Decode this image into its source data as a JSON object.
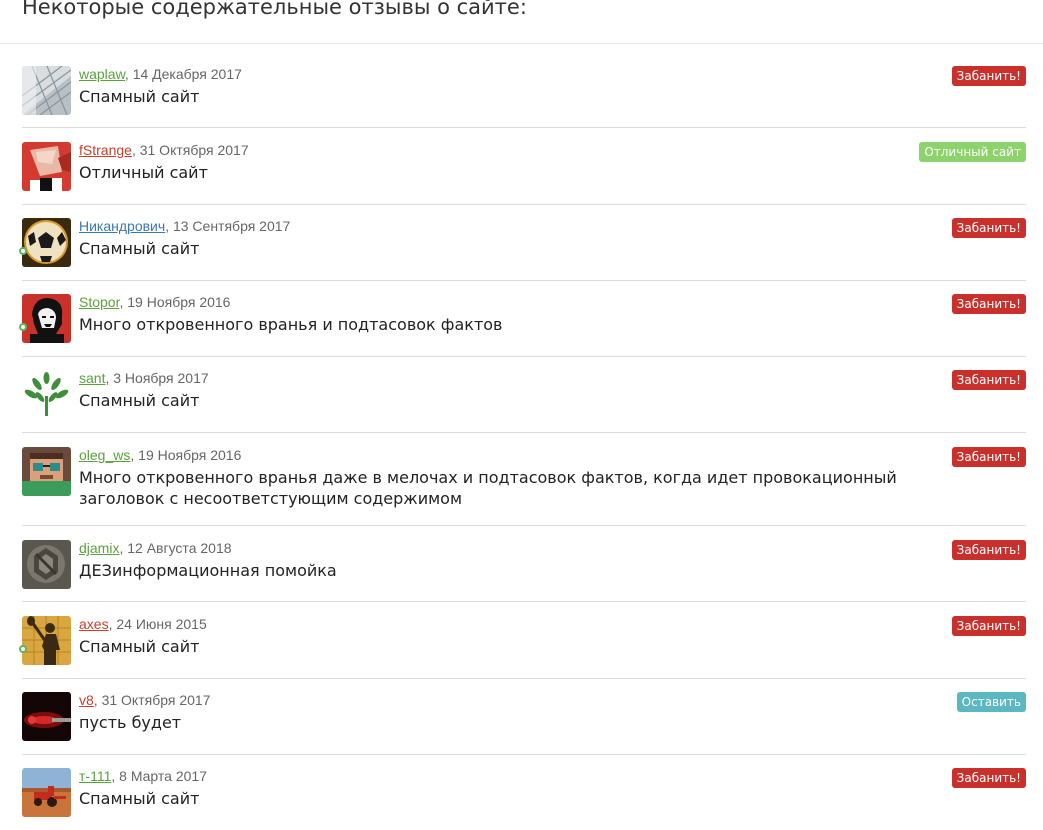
{
  "page": {
    "title": "Некоторые содержательные отзывы о сайте:"
  },
  "colors": {
    "ban": "#c9302c",
    "good": "#8dd36b",
    "keep": "#5bb8c3",
    "online": "#5cb85c"
  },
  "reviews": [
    {
      "user": "waplaw",
      "date": "14 Декабря 2017",
      "text": "Спамный сайт",
      "badge": "Забанить!",
      "badge_type": "ban",
      "user_color": "green",
      "online": false,
      "avatar": "glass-building"
    },
    {
      "user": "fStrange",
      "date": "31 Октября 2017",
      "text": "Отличный сайт",
      "badge": "Отличный сайт",
      "badge_type": "good",
      "user_color": "red",
      "online": false,
      "avatar": "red-abstract-face"
    },
    {
      "user": "Никандрович",
      "date": "13 Сентября 2017",
      "text": "Спамный сайт",
      "badge": "Забанить!",
      "badge_type": "ban",
      "user_color": "blue",
      "online": true,
      "avatar": "soccer-ball"
    },
    {
      "user": "Stopor",
      "date": "19 Ноября 2016",
      "text": "Много откровенного вранья и подтасовок фактов",
      "badge": "Забанить!",
      "badge_type": "ban",
      "user_color": "green",
      "online": true,
      "avatar": "che-portrait"
    },
    {
      "user": "sant",
      "date": "3 Ноября 2017",
      "text": "Спамный сайт",
      "badge": "Забанить!",
      "badge_type": "ban",
      "user_color": "green",
      "online": false,
      "avatar": "green-tree"
    },
    {
      "user": "oleg_ws",
      "date": "19 Ноября 2016",
      "text": "Много откровенного вранья даже в мелочах и подтасовок фактов, когда идет провокационный заголовок с несоответстующим содержимом",
      "badge": "Забанить!",
      "badge_type": "ban",
      "user_color": "green",
      "online": false,
      "avatar": "pixel-character"
    },
    {
      "user": "djamix",
      "date": "12 Августа 2018",
      "text": "ДЕЗинформационная помойка",
      "badge": "Забанить!",
      "badge_type": "ban",
      "user_color": "green",
      "online": false,
      "avatar": "metal-emblem"
    },
    {
      "user": "axes",
      "date": "24 Июня 2015",
      "text": "Спамный сайт",
      "badge": "Забанить!",
      "badge_type": "ban",
      "user_color": "red",
      "online": true,
      "avatar": "shovel-silhouette"
    },
    {
      "user": "v8",
      "date": "31 Октября 2017",
      "text": "пусть будет",
      "badge": "Оставить",
      "badge_type": "keep",
      "user_color": "red",
      "online": false,
      "avatar": "red-dark-blur"
    },
    {
      "user": "т-111",
      "date": "8 Марта 2017",
      "text": "Спамный сайт",
      "badge": "Забанить!",
      "badge_type": "ban",
      "user_color": "green",
      "online": false,
      "avatar": "red-tractor-field"
    }
  ]
}
